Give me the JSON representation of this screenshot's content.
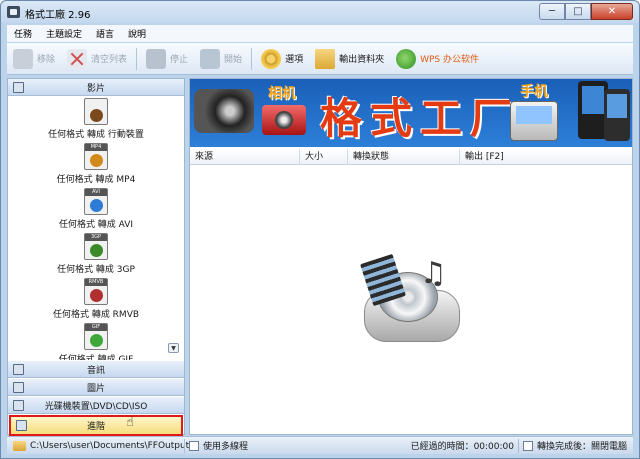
{
  "window": {
    "title": "格式工廠 2.96",
    "min_glyph": "─",
    "max_glyph": "□",
    "close_glyph": "✕"
  },
  "menu": {
    "items": [
      "任務",
      "主題設定",
      "語言",
      "說明"
    ]
  },
  "toolbar": {
    "remove": "移除",
    "clear": "清空列表",
    "stop": "停止",
    "start": "開始",
    "options": "選項",
    "output_folder": "輸出資料夾",
    "wps": "WPS 办公软件"
  },
  "left_panel": {
    "video_category": "影片",
    "conversions": [
      {
        "label": "任何格式 轉成 行動裝置",
        "tag": "",
        "color": "#7a4a1e"
      },
      {
        "label": "任何格式 轉成 MP4",
        "tag": "MP4",
        "color": "#d28a1a"
      },
      {
        "label": "任何格式 轉成 AVI",
        "tag": "AVI",
        "color": "#2d7dd6"
      },
      {
        "label": "任何格式 轉成 3GP",
        "tag": "3GP",
        "color": "#3a8a2a"
      },
      {
        "label": "任何格式 轉成 RMVB",
        "tag": "RMVB",
        "color": "#b03030"
      },
      {
        "label": "任何格式 轉成 GIF",
        "tag": "GIF",
        "color": "#3fa83a"
      }
    ],
    "audio_category": "音訊",
    "image_category": "圖片",
    "rom_category": "光碟機裝置\\DVD\\CD\\ISO",
    "advanced_category": "進階"
  },
  "banner": {
    "title": "格式工厂",
    "camera_label": "相机",
    "phone_label": "手机"
  },
  "task_list": {
    "columns": [
      "來源",
      "大小",
      "轉換狀態",
      "輸出 [F2]"
    ]
  },
  "status_bar": {
    "output_path": "C:\\Users\\user\\Documents\\FFOutput",
    "multi_thread": "使用多線程",
    "elapsed_label": "已經過的時間：00:00:00",
    "after_convert": "轉換完成後：關閉電腦"
  }
}
